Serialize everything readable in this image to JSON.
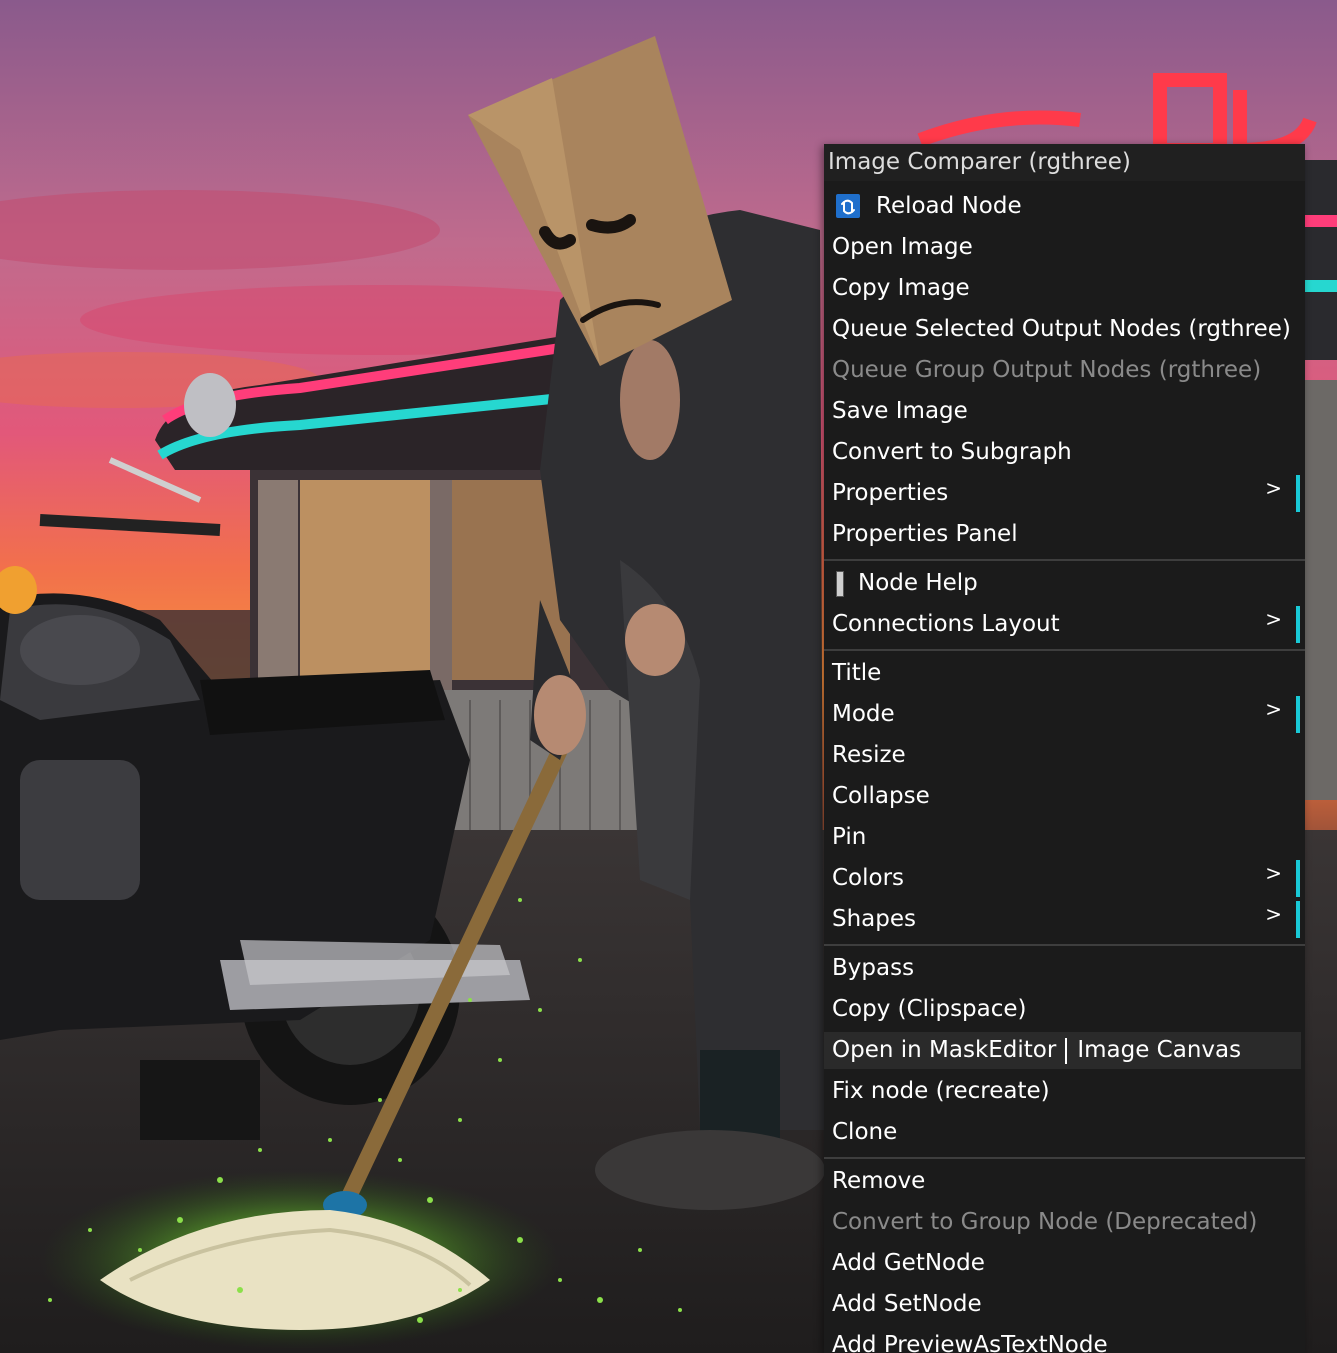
{
  "menu": {
    "title": "Image Comparer (rgthree)",
    "items": [
      {
        "label": "Reload Node",
        "icon": "reload-icon"
      },
      {
        "label": "Open Image"
      },
      {
        "label": "Copy Image"
      },
      {
        "label": "Queue Selected Output Nodes (rgthree)"
      },
      {
        "label": "Queue Group Output Nodes (rgthree)",
        "disabled": true
      },
      {
        "label": "Save Image"
      },
      {
        "label": "Convert to Subgraph"
      },
      {
        "label": "Properties",
        "submenu": true
      },
      {
        "label": "Properties Panel"
      },
      {
        "label": "Node Help",
        "icon": "help-icon"
      },
      {
        "label": "Connections Layout",
        "submenu": true
      },
      {
        "label": "Title"
      },
      {
        "label": "Mode",
        "submenu": true
      },
      {
        "label": "Resize"
      },
      {
        "label": "Collapse"
      },
      {
        "label": "Pin"
      },
      {
        "label": "Colors",
        "submenu": true
      },
      {
        "label": "Shapes",
        "submenu": true
      },
      {
        "label": "Bypass"
      },
      {
        "label": "Copy (Clipspace)"
      },
      {
        "label": "Open in MaskEditor",
        "label2": "Image Canvas",
        "highlighted": true
      },
      {
        "label": "Fix node (recreate)"
      },
      {
        "label": "Clone"
      },
      {
        "label": "Remove"
      },
      {
        "label": "Convert to Group Node (Deprecated)",
        "disabled": true
      },
      {
        "label": "Add GetNode"
      },
      {
        "label": "Add SetNode"
      },
      {
        "label": "Add PreviewAsTextNode"
      }
    ],
    "submenu_arrow": ">",
    "accent_color": "#19c9d6",
    "disabled_color": "#8a8a8a"
  },
  "background": {
    "sign_text": "ьпАЯ"
  }
}
